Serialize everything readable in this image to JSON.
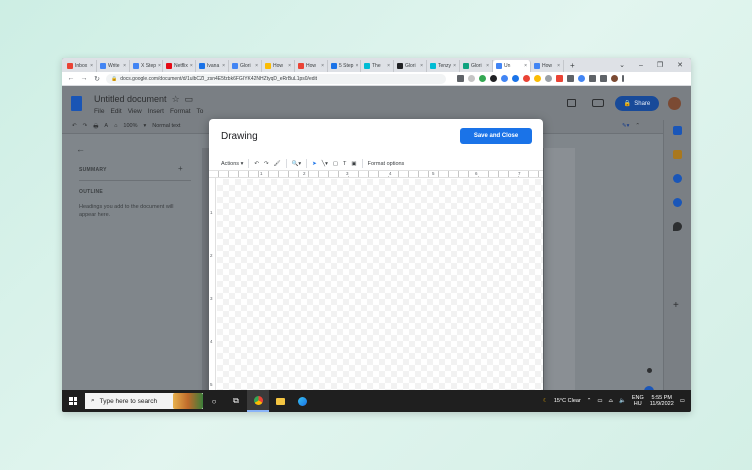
{
  "browser": {
    "tabs": [
      {
        "label": "Inbox",
        "color": "#ea4335"
      },
      {
        "label": "Write",
        "color": "#4285f4"
      },
      {
        "label": "X Step",
        "color": "#4285f4"
      },
      {
        "label": "Netflix",
        "color": "#e50914"
      },
      {
        "label": "Ivana",
        "color": "#1a73e8"
      },
      {
        "label": "Glori",
        "color": "#4285f4"
      },
      {
        "label": "How",
        "color": "#fbbc04"
      },
      {
        "label": "How",
        "color": "#ea4335"
      },
      {
        "label": "5 Step",
        "color": "#1a73e8"
      },
      {
        "label": "The",
        "color": "#00bcd4"
      },
      {
        "label": "Glori",
        "color": "#202124"
      },
      {
        "label": "Tenzy",
        "color": "#00bcd4"
      },
      {
        "label": "Glori",
        "color": "#10a37f"
      },
      {
        "label": "Un",
        "color": "#4285f4",
        "active": true
      },
      {
        "label": "How",
        "color": "#4285f4"
      }
    ],
    "url": "docs.google.com/document/d/1ulbCZI_zsn4E5fzbk6FGIYK42NHZtyqD_eRrBuL1ps0/edit"
  },
  "docs": {
    "title": "Untitled document",
    "menus": [
      "File",
      "Edit",
      "View",
      "Insert",
      "Format",
      "To"
    ],
    "share_label": "Share",
    "toolbar": [
      "↶",
      "↷",
      "🖶",
      "A",
      "⌂",
      "100%",
      "▾",
      "Normal text"
    ],
    "outline": {
      "summary": "SUMMARY",
      "outline": "OUTLINE",
      "hint": "Headings you add to the document will appear here."
    }
  },
  "drawing": {
    "title": "Drawing",
    "save_label": "Save and Close",
    "toolbar": {
      "actions": "Actions",
      "format_options": "Format options"
    },
    "ruler_h": [
      "1",
      "2",
      "3",
      "4",
      "5",
      "6",
      "7"
    ],
    "ruler_v": [
      "1",
      "2",
      "3",
      "4",
      "5",
      "6"
    ]
  },
  "taskbar": {
    "search_placeholder": "Type here to search",
    "weather": "15°C  Clear",
    "lang_top": "ENG",
    "lang_bottom": "HU",
    "time": "5:55 PM",
    "date": "11/9/2022"
  },
  "colors": {
    "accent": "#1a73e8",
    "share": "#184a99"
  }
}
